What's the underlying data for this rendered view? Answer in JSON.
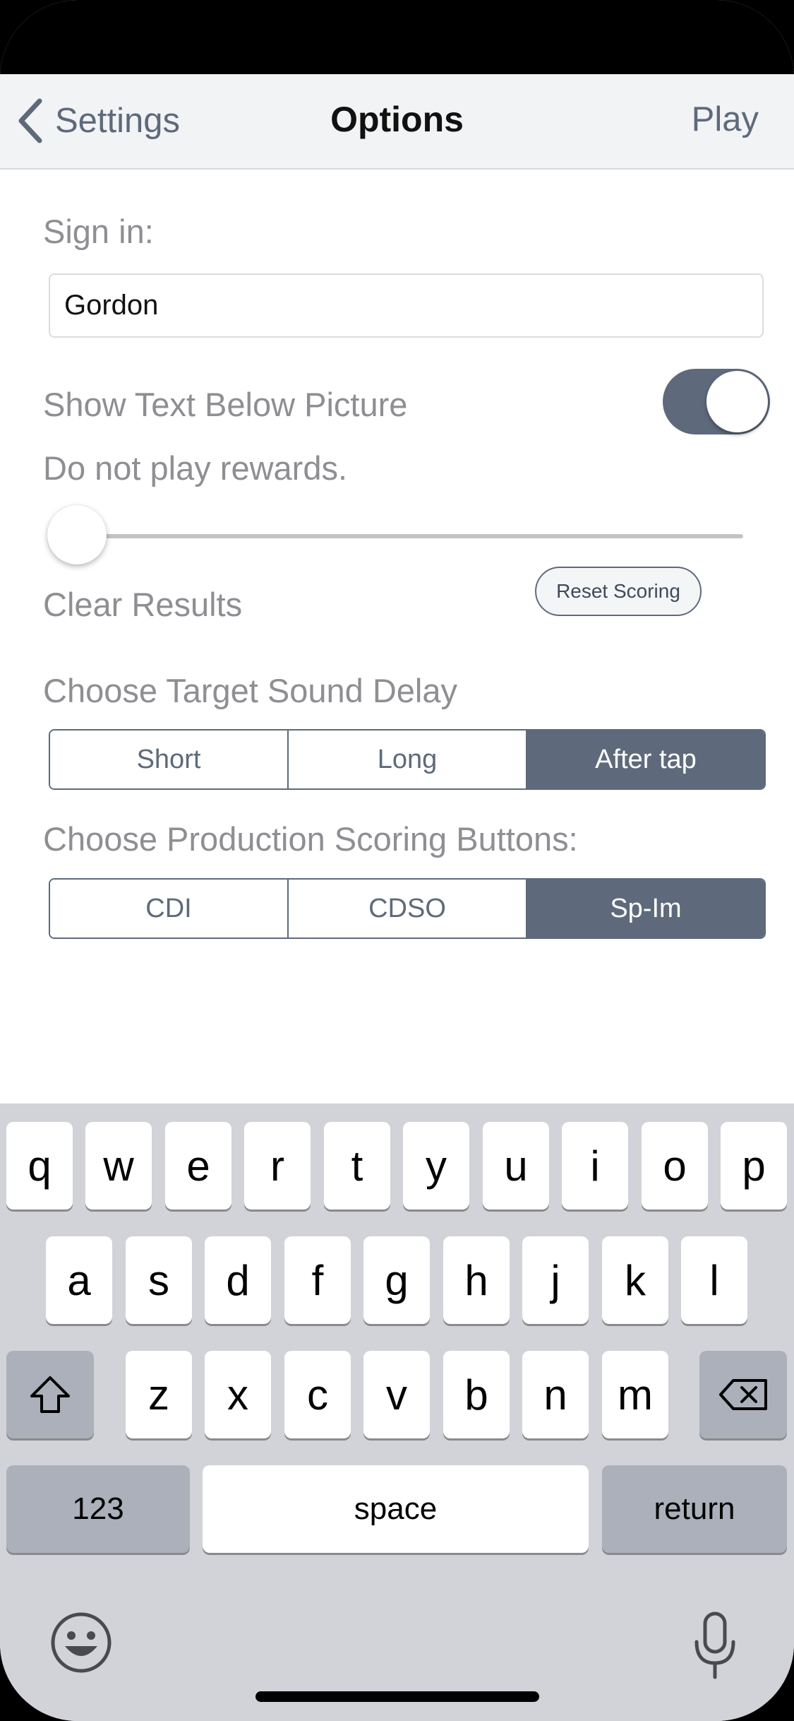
{
  "navbar": {
    "back_label": "Settings",
    "title": "Options",
    "play_label": "Play"
  },
  "signin": {
    "label": "Sign in:",
    "value": "Gordon"
  },
  "show_text": {
    "label": "Show Text Below Picture",
    "enabled": true
  },
  "rewards": {
    "label": "Do not play rewards.",
    "slider_value": 0
  },
  "clear_results": {
    "label": "Clear Results",
    "button_label": "Reset Scoring"
  },
  "sound_delay": {
    "label": "Choose Target Sound Delay",
    "options": [
      "Short",
      "Long",
      "After tap"
    ],
    "selected": "After tap"
  },
  "scoring_buttons": {
    "label": "Choose Production Scoring Buttons:",
    "options": [
      "CDI",
      "CDSO",
      "Sp-Im"
    ],
    "selected": "Sp-Im"
  },
  "keyboard": {
    "row1": [
      "q",
      "w",
      "e",
      "r",
      "t",
      "y",
      "u",
      "i",
      "o",
      "p"
    ],
    "row2": [
      "a",
      "s",
      "d",
      "f",
      "g",
      "h",
      "j",
      "k",
      "l"
    ],
    "row3": [
      "z",
      "x",
      "c",
      "v",
      "b",
      "n",
      "m"
    ],
    "numbers_label": "123",
    "space_label": "space",
    "return_label": "return"
  },
  "colors": {
    "accent": "#5e6a7b",
    "label_gray": "#8e8e93",
    "keyboard_bg": "#d1d3d9"
  }
}
